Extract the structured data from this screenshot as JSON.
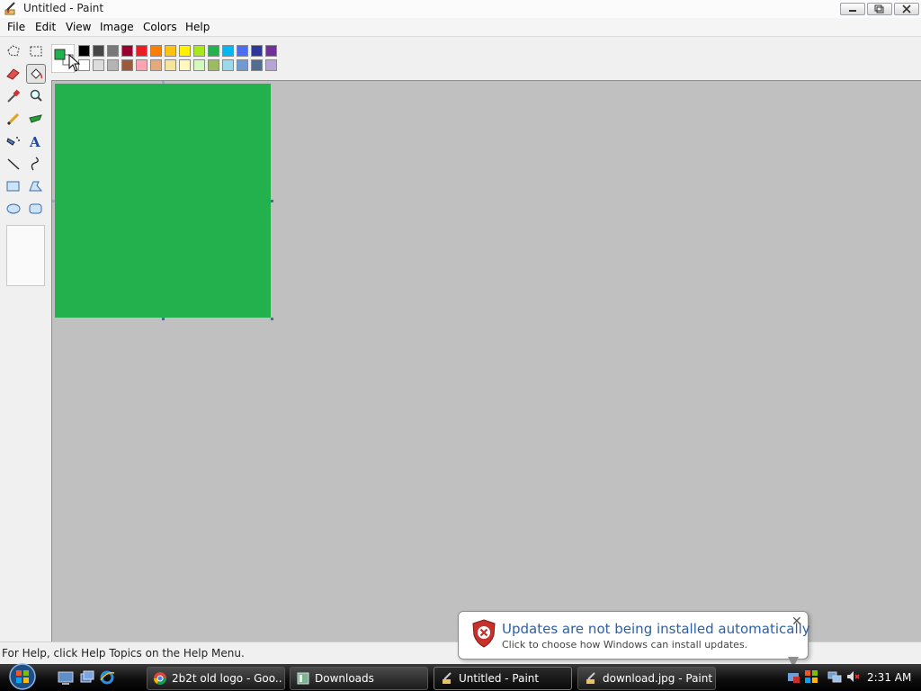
{
  "window": {
    "title": "Untitled - Paint"
  },
  "menu": [
    "File",
    "Edit",
    "View",
    "Image",
    "Colors",
    "Help"
  ],
  "toolbox": {
    "tools": [
      {
        "name": "free-form-select"
      },
      {
        "name": "select"
      },
      {
        "name": "eraser"
      },
      {
        "name": "fill-with-color",
        "selected": true
      },
      {
        "name": "pick-color"
      },
      {
        "name": "magnifier"
      },
      {
        "name": "pencil"
      },
      {
        "name": "brush"
      },
      {
        "name": "airbrush"
      },
      {
        "name": "text"
      },
      {
        "name": "line"
      },
      {
        "name": "curve"
      },
      {
        "name": "rectangle"
      },
      {
        "name": "polygon"
      },
      {
        "name": "ellipse"
      },
      {
        "name": "rounded-rectangle"
      }
    ]
  },
  "palette": {
    "primary_color": "#22b14c",
    "secondary_color": "#ffffff",
    "row1": [
      "#000000",
      "#464646",
      "#787878",
      "#990030",
      "#ed1c24",
      "#ff7e00",
      "#ffc20e",
      "#fff200",
      "#a8e61d",
      "#22b14c",
      "#00b7ef",
      "#4d6df3",
      "#2f3699",
      "#6f3198"
    ],
    "row2": [
      "#ffffff",
      "#dcdcdc",
      "#b4b4b4",
      "#9c5a3c",
      "#ffa3b1",
      "#e5aa7a",
      "#f5e49c",
      "#fff9bd",
      "#d3f9bc",
      "#9dbb61",
      "#99d9ea",
      "#709ad1",
      "#546d8e",
      "#b5a5d5"
    ]
  },
  "canvas": {
    "fill_color": "#22b14c"
  },
  "statusbar": {
    "text": "For Help, click Help Topics on the Help Menu."
  },
  "balloon": {
    "title": "Updates are not being installed automatically",
    "text": "Click to choose how Windows can install updates."
  },
  "taskbar": {
    "tasks": [
      {
        "label": "2b2t old logo - Goo...",
        "icon": "chrome-icon"
      },
      {
        "label": "Downloads",
        "icon": "folder-icon"
      },
      {
        "label": "Untitled - Paint",
        "icon": "paint-icon",
        "active": true
      },
      {
        "label": "download.jpg - Paint",
        "icon": "paint-icon"
      }
    ],
    "clock": "2:31 AM"
  }
}
